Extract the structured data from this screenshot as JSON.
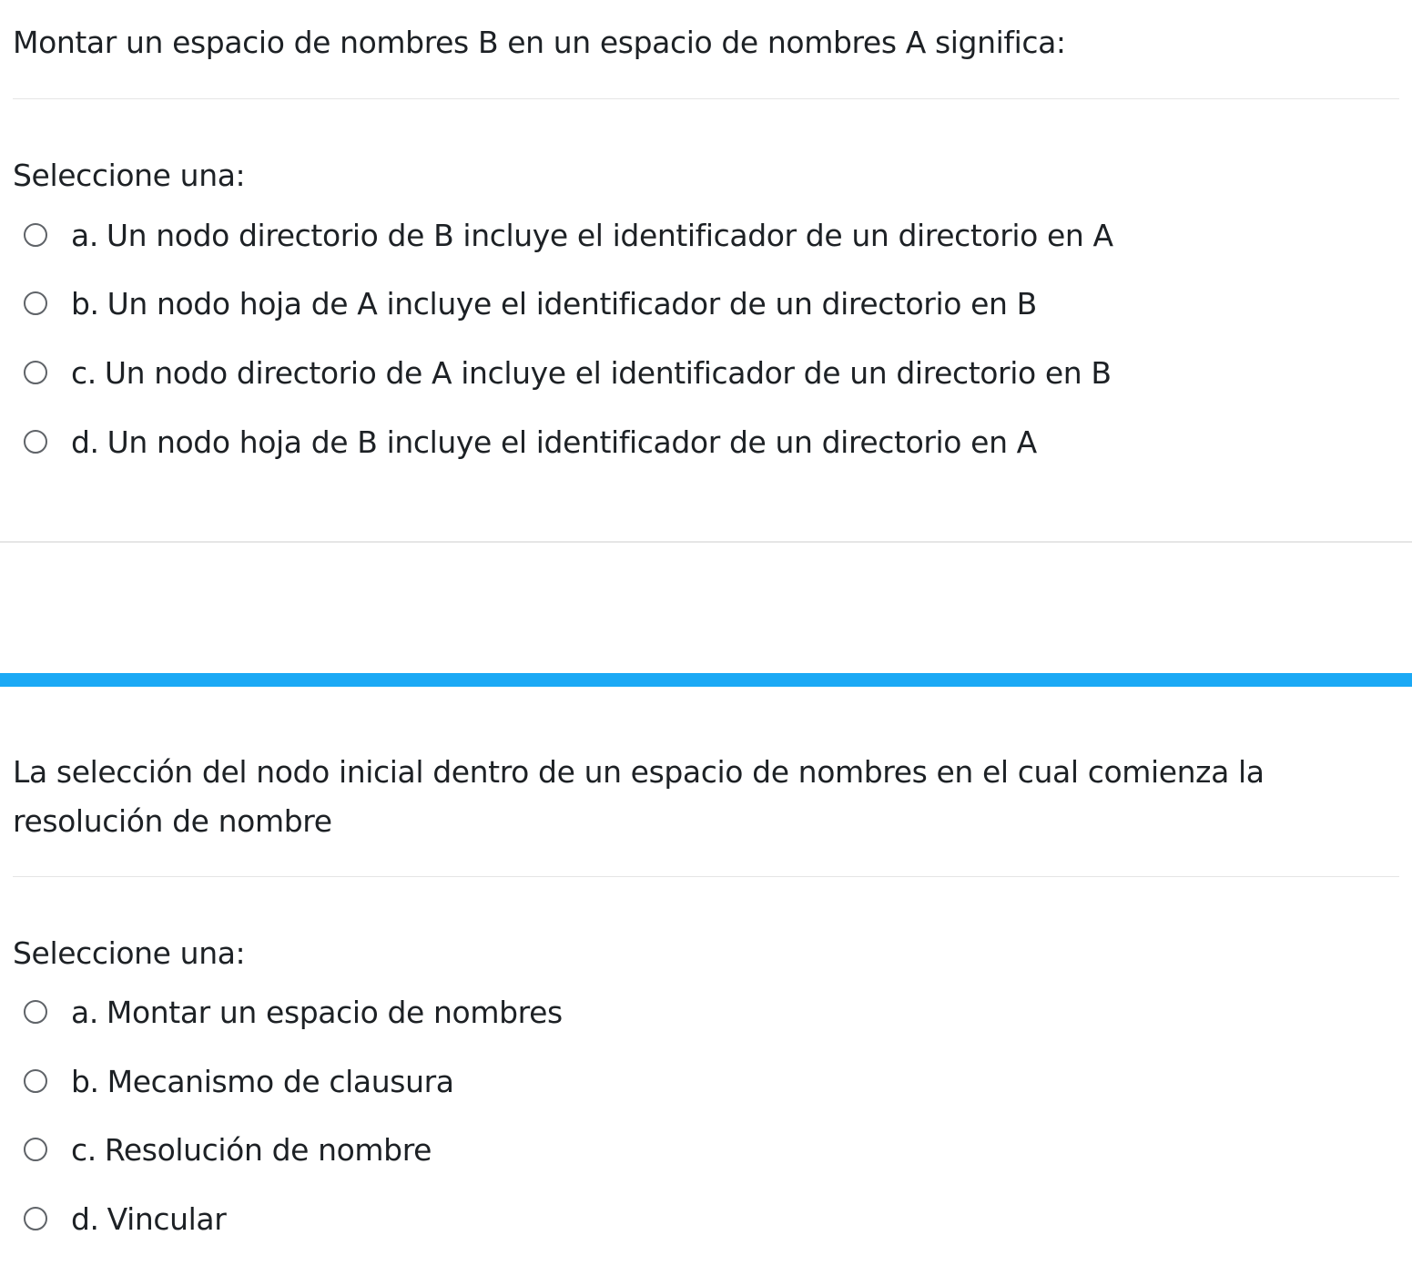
{
  "colors": {
    "accent_bar": "#1ba9f5",
    "text": "#1d2125",
    "divider": "#e5e5e5"
  },
  "questions": [
    {
      "text": "Montar un espacio de nombres B en un espacio de nombres A significa:",
      "prompt": "Seleccione una:",
      "options": [
        {
          "letter": "a.",
          "text": "Un nodo directorio de B incluye el identificador de un directorio en A"
        },
        {
          "letter": "b.",
          "text": "Un nodo hoja de A incluye el identificador de un directorio en B"
        },
        {
          "letter": "c.",
          "text": "Un nodo directorio de A incluye el identificador de un directorio en B"
        },
        {
          "letter": "d.",
          "text": "Un nodo hoja de B incluye el identificador de un directorio en A"
        }
      ]
    },
    {
      "text": "La selección del nodo inicial dentro de un espacio de nombres en el cual comienza la resolución de nombre",
      "prompt": "Seleccione una:",
      "options": [
        {
          "letter": "a.",
          "text": "Montar un espacio de nombres"
        },
        {
          "letter": "b.",
          "text": "Mecanismo de clausura"
        },
        {
          "letter": "c.",
          "text": "Resolución de nombre"
        },
        {
          "letter": "d.",
          "text": "Vincular"
        }
      ]
    }
  ]
}
